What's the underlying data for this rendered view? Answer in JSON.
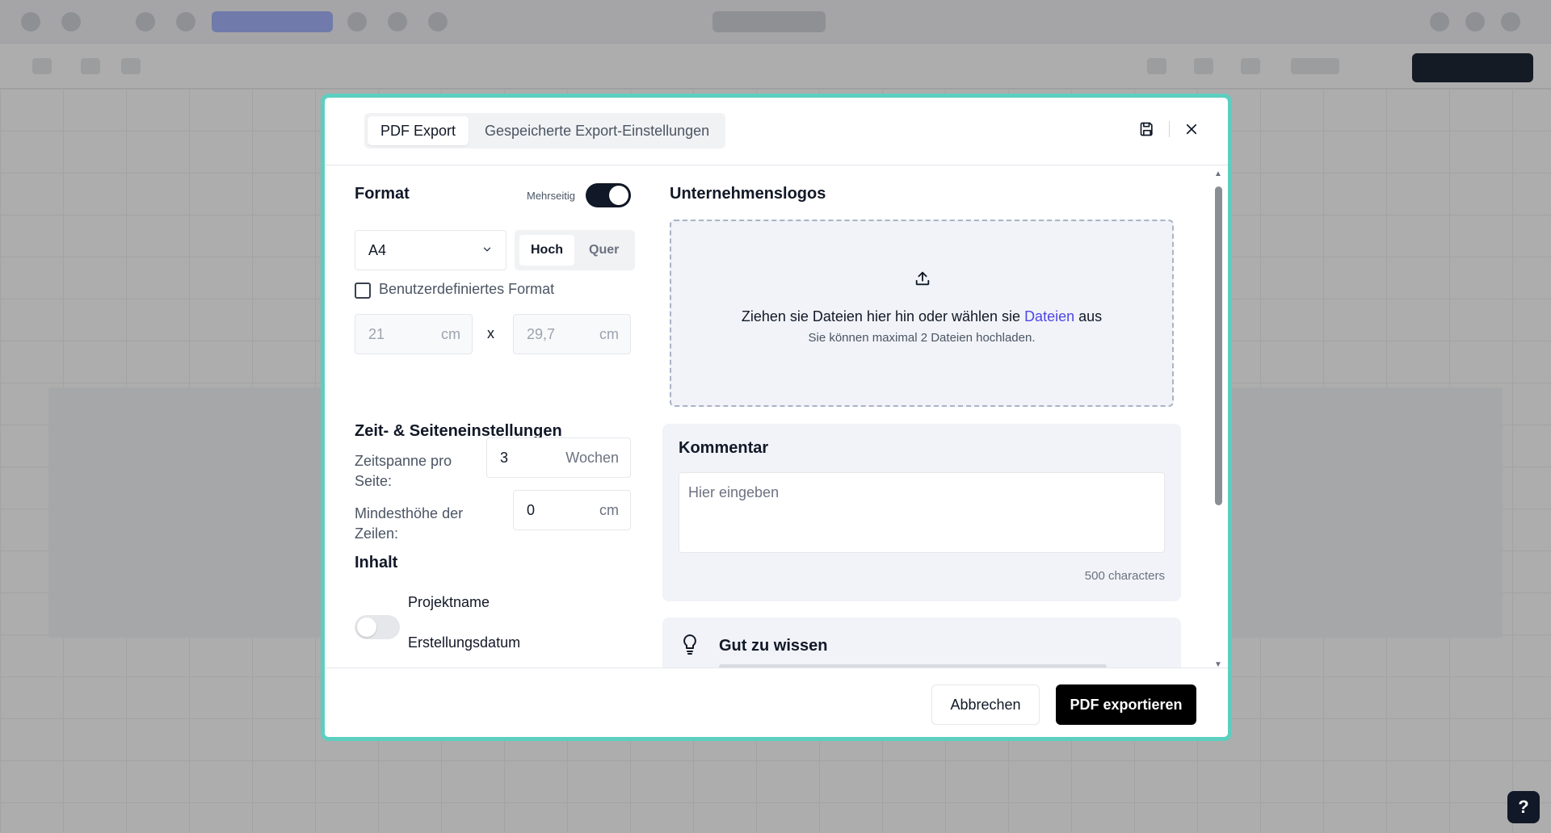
{
  "modal": {
    "tabs": [
      {
        "label": "PDF Export",
        "active": true
      },
      {
        "label": "Gespeicherte Export-Einstellungen",
        "active": false
      }
    ],
    "icons": {
      "save": "save-icon",
      "close": "close-icon"
    }
  },
  "format": {
    "title": "Format",
    "multipage_label": "Mehrseitig",
    "multipage_on": true,
    "paper_size": "A4",
    "orientation_options": [
      "Hoch",
      "Quer"
    ],
    "orientation_selected": "Hoch",
    "custom_format_label": "Benutzerdefiniertes Format",
    "custom_format_checked": false,
    "width_value": "21",
    "height_value": "29,7",
    "unit_cm": "cm",
    "times_symbol": "x"
  },
  "time_page": {
    "title": "Zeit- & Seiteneinstellungen",
    "span_label_line1": "Zeitspanne pro",
    "span_label_line2": "Seite:",
    "span_value": "3",
    "span_unit": "Wochen",
    "row_height_label_line1": "Mindesthöhe der",
    "row_height_label_line2": "Zeilen:",
    "row_height_value": "0",
    "row_height_unit": "cm"
  },
  "content": {
    "title": "Inhalt",
    "toggles": [
      {
        "label": "Projektname",
        "on": false
      },
      {
        "label": "Erstellungsdatum",
        "on": false
      }
    ]
  },
  "logos": {
    "title": "Unternehmenslogos",
    "drop_text_before": "Ziehen sie Dateien hier hin oder wählen sie ",
    "drop_link": "Dateien",
    "drop_text_after": " aus",
    "drop_hint": "Sie können maximal 2 Dateien hochladen."
  },
  "comment": {
    "title": "Kommentar",
    "placeholder": "Hier eingeben",
    "char_limit": "500 characters"
  },
  "tip": {
    "title": "Gut zu wissen"
  },
  "footer": {
    "cancel_label": "Abbrechen",
    "export_label": "PDF exportieren"
  },
  "help": {
    "label": "?"
  },
  "colors": {
    "modal_border": "#5ccfc0",
    "primary": "#000000",
    "link": "#4f46e5"
  }
}
